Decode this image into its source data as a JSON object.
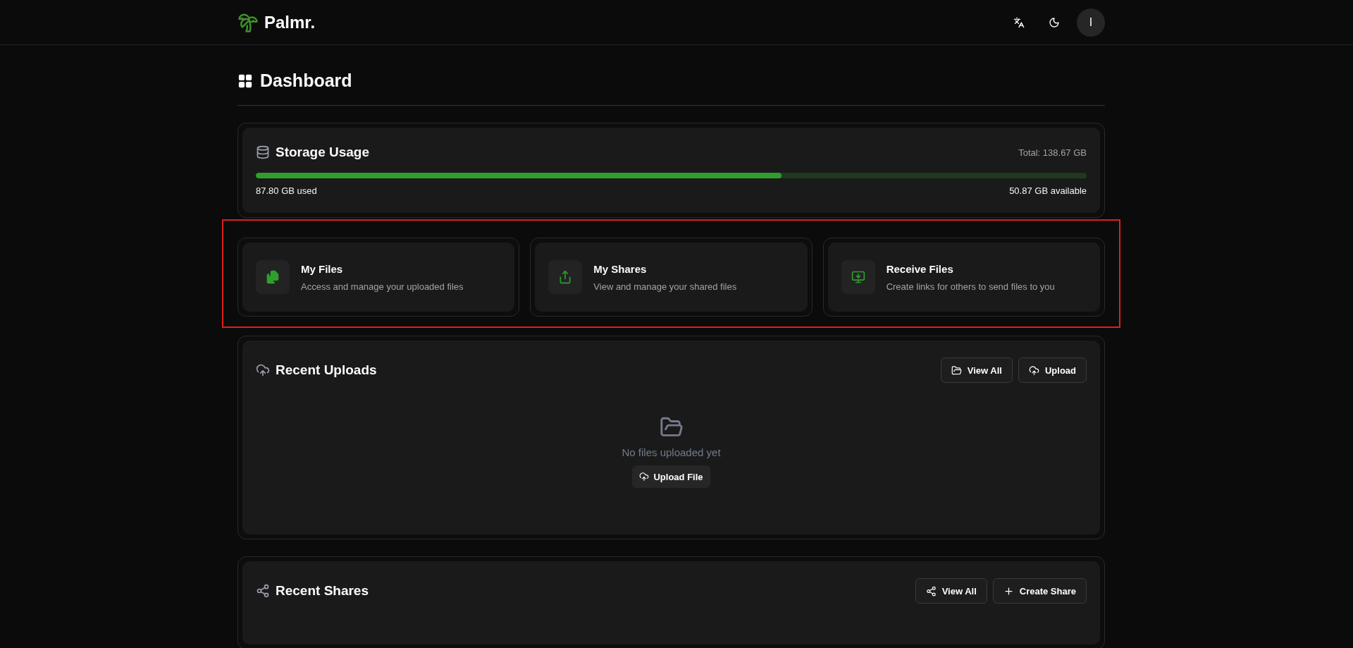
{
  "header": {
    "brand": "Palmr.",
    "avatar_initial": "I"
  },
  "page": {
    "title": "Dashboard"
  },
  "storage": {
    "title": "Storage Usage",
    "total": "Total: 138.67 GB",
    "level": 0.633,
    "used": "87.80 GB used",
    "available": "50.87 GB available"
  },
  "quick_actions": [
    {
      "kind": "files",
      "title": "My Files",
      "description": "Access and manage your uploaded files"
    },
    {
      "kind": "shares",
      "title": "My Shares",
      "description": "View and manage your shared files"
    },
    {
      "kind": "receive",
      "title": "Receive Files",
      "description": "Create links for others to send files to you"
    }
  ],
  "recent_uploads": {
    "title": "Recent Uploads",
    "buttons": [
      {
        "kind": "view",
        "label": "View All"
      },
      {
        "kind": "upload",
        "label": "Upload"
      }
    ],
    "empty_text": "No files uploaded yet",
    "empty_button": "Upload File"
  },
  "recent_shares": {
    "title": "Recent Shares",
    "buttons": [
      {
        "kind": "share",
        "label": "View All"
      },
      {
        "kind": "plus",
        "label": "Create Share"
      }
    ]
  }
}
